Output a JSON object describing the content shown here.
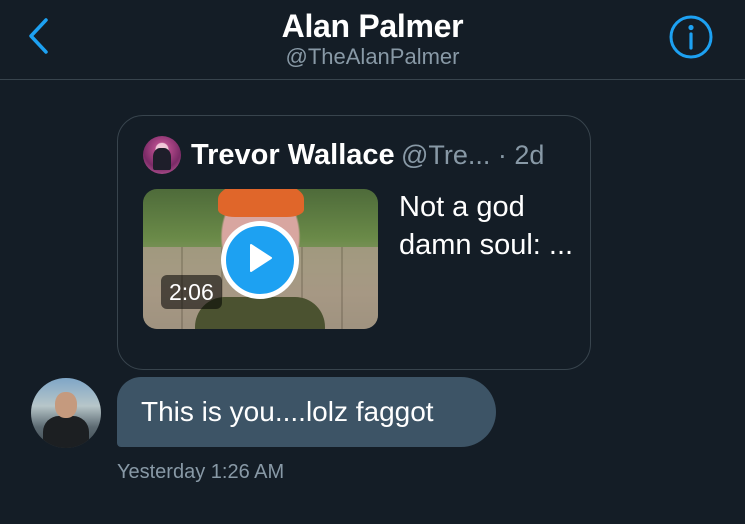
{
  "header": {
    "title": "Alan Palmer",
    "handle": "@TheAlanPalmer"
  },
  "icons": {
    "back": "chevron-left",
    "info": "info-circle",
    "play": "play-triangle"
  },
  "colors": {
    "background": "#141d26",
    "accent": "#1da1f2",
    "bubble": "#3d5466",
    "secondary_text": "#8899a6",
    "divider": "#38444d"
  },
  "quoted_tweet": {
    "author_name": "Trevor Wallace",
    "author_meta": "@Tre... · 2d",
    "video_duration": "2:06",
    "text": "Not a god damn soul: ..."
  },
  "message": {
    "text": "This is you....lolz faggot",
    "timestamp": "Yesterday 1:26 AM"
  }
}
